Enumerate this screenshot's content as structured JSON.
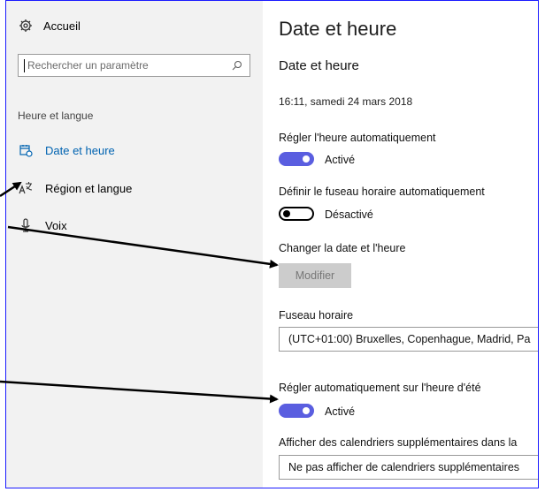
{
  "sidebar": {
    "home_label": "Accueil",
    "search_placeholder": "Rechercher un paramètre",
    "section_title": "Heure et langue",
    "items": [
      {
        "label": "Date et heure",
        "icon": "calendar-clock-icon",
        "active": true
      },
      {
        "label": "Région et langue",
        "icon": "language-icon",
        "active": false
      },
      {
        "label": "Voix",
        "icon": "microphone-icon",
        "active": false
      }
    ]
  },
  "main": {
    "page_title": "Date et heure",
    "section_title": "Date et heure",
    "current_time": "16:11, samedi 24 mars 2018",
    "auto_time": {
      "label": "Régler l'heure automatiquement",
      "state": "Activé"
    },
    "auto_timezone": {
      "label": "Définir le fuseau horaire automatiquement",
      "state": "Désactivé"
    },
    "change_datetime": {
      "label": "Changer la date et l'heure",
      "button": "Modifier"
    },
    "timezone": {
      "label": "Fuseau horaire",
      "value": "(UTC+01:00) Bruxelles, Copenhague, Madrid, Pa"
    },
    "dst": {
      "label": "Régler automatiquement sur l'heure d'été",
      "state": "Activé"
    },
    "calendars": {
      "label": "Afficher des calendriers supplémentaires dans la",
      "value": "Ne pas afficher de calendriers supplémentaires"
    }
  },
  "colors": {
    "accent": "#5a5ee0",
    "link_active": "#0063b1",
    "frame_border": "#1a1aff"
  }
}
